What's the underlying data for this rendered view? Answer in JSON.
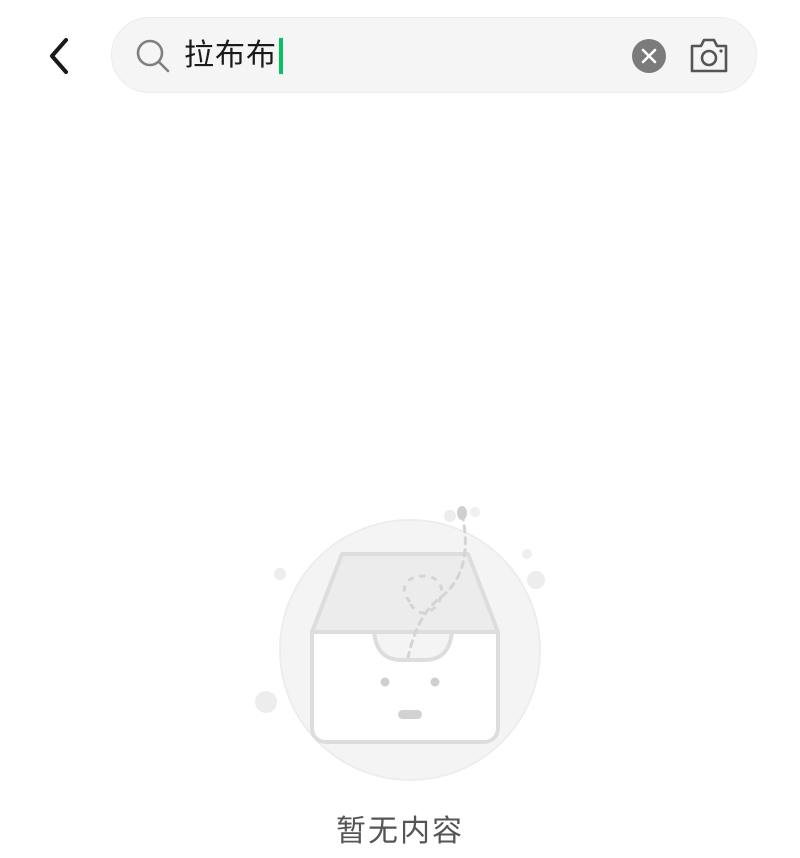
{
  "header": {
    "back_icon": "chevron-left-icon",
    "search": {
      "icon": "search-icon",
      "value": "拉布布",
      "cursor_color": "#07c160",
      "clear_icon": "clear-circle-icon",
      "camera_icon": "camera-icon"
    }
  },
  "empty_state": {
    "illustration": "empty-inbox-box-icon",
    "message": "暂无内容"
  },
  "colors": {
    "background": "#ffffff",
    "search_bg": "#f5f5f5",
    "accent": "#07c160",
    "icon_gray": "#7f7f7f",
    "text_secondary": "#555555"
  }
}
